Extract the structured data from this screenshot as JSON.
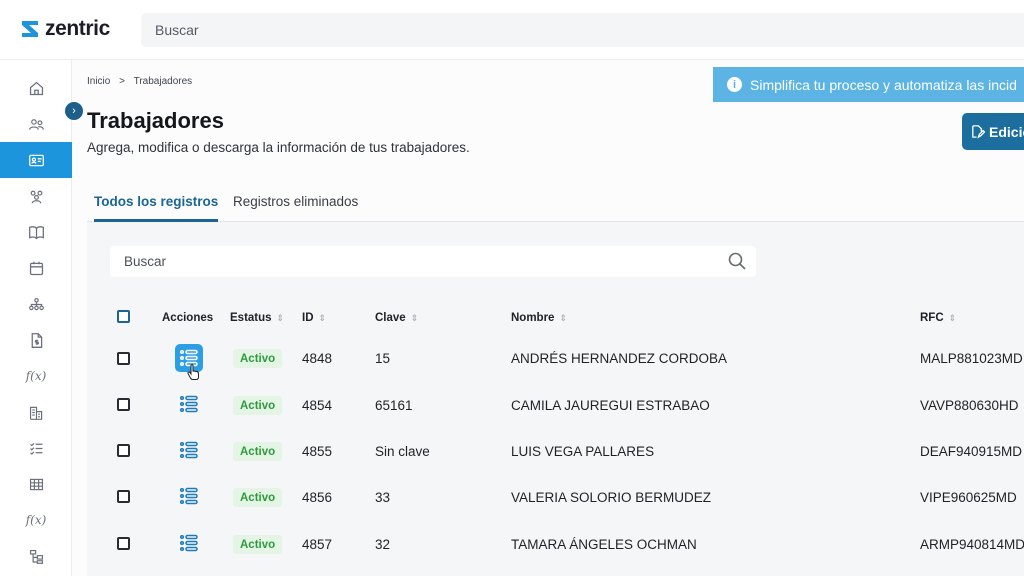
{
  "app": {
    "logo_text": "zentric"
  },
  "topbar": {
    "search_placeholder": "Buscar"
  },
  "sidebar": {
    "items": [
      {
        "icon": "home-icon"
      },
      {
        "icon": "users-icon"
      },
      {
        "icon": "id-card-icon",
        "active": true
      },
      {
        "icon": "user-group-icon"
      },
      {
        "icon": "book-icon"
      },
      {
        "icon": "calendar-icon"
      },
      {
        "icon": "org-chart-icon"
      },
      {
        "icon": "payroll-document-icon"
      },
      {
        "icon": "formula-icon",
        "text": "f(x)"
      },
      {
        "icon": "building-report-icon"
      },
      {
        "icon": "list-checks-icon"
      },
      {
        "icon": "table-grid-icon"
      },
      {
        "icon": "formula-icon",
        "text": "f(x)"
      },
      {
        "icon": "hierarchy-icon"
      }
    ]
  },
  "breadcrumb": {
    "home": "Inicio",
    "separator": ">",
    "current": "Trabajadores"
  },
  "banner": {
    "text": "Simplifica tu proceso y automatiza las incid"
  },
  "header": {
    "title": "Trabajadores",
    "subtitle": "Agrega, modifica o descarga la información de tus trabajadores.",
    "edit_button": "Edicio"
  },
  "tabs": [
    {
      "label": "Todos los registros",
      "active": true
    },
    {
      "label": "Registros eliminados",
      "active": false
    }
  ],
  "grid": {
    "search_placeholder": "Buscar",
    "columns": {
      "acciones": "Acciones",
      "estatus": "Estatus",
      "id": "ID",
      "clave": "Clave",
      "nombre": "Nombre",
      "rfc": "RFC"
    },
    "rows": [
      {
        "estatus": "Activo",
        "id": "4848",
        "clave": "15",
        "nombre": "ANDRÉS HERNANDEZ CORDOBA",
        "rfc": "MALP881023MD"
      },
      {
        "estatus": "Activo",
        "id": "4854",
        "clave": "65161",
        "nombre": "CAMILA JAUREGUI ESTRABAO",
        "rfc": "VAVP880630HD"
      },
      {
        "estatus": "Activo",
        "id": "4855",
        "clave": "Sin clave",
        "nombre": "LUIS VEGA PALLARES",
        "rfc": "DEAF940915MD"
      },
      {
        "estatus": "Activo",
        "id": "4856",
        "clave": "33",
        "nombre": "VALERIA SOLORIO BERMUDEZ",
        "rfc": "VIPE960625MD"
      },
      {
        "estatus": "Activo",
        "id": "4857",
        "clave": "32",
        "nombre": "TAMARA ÁNGELES OCHMAN",
        "rfc": "ARMP940814MD"
      }
    ]
  },
  "colors": {
    "primary": "#1d95dc",
    "dark_primary": "#1b6594",
    "banner": "#5bb4e4",
    "badge_bg": "#e4f5e6",
    "badge_text": "#2e9a3d"
  }
}
